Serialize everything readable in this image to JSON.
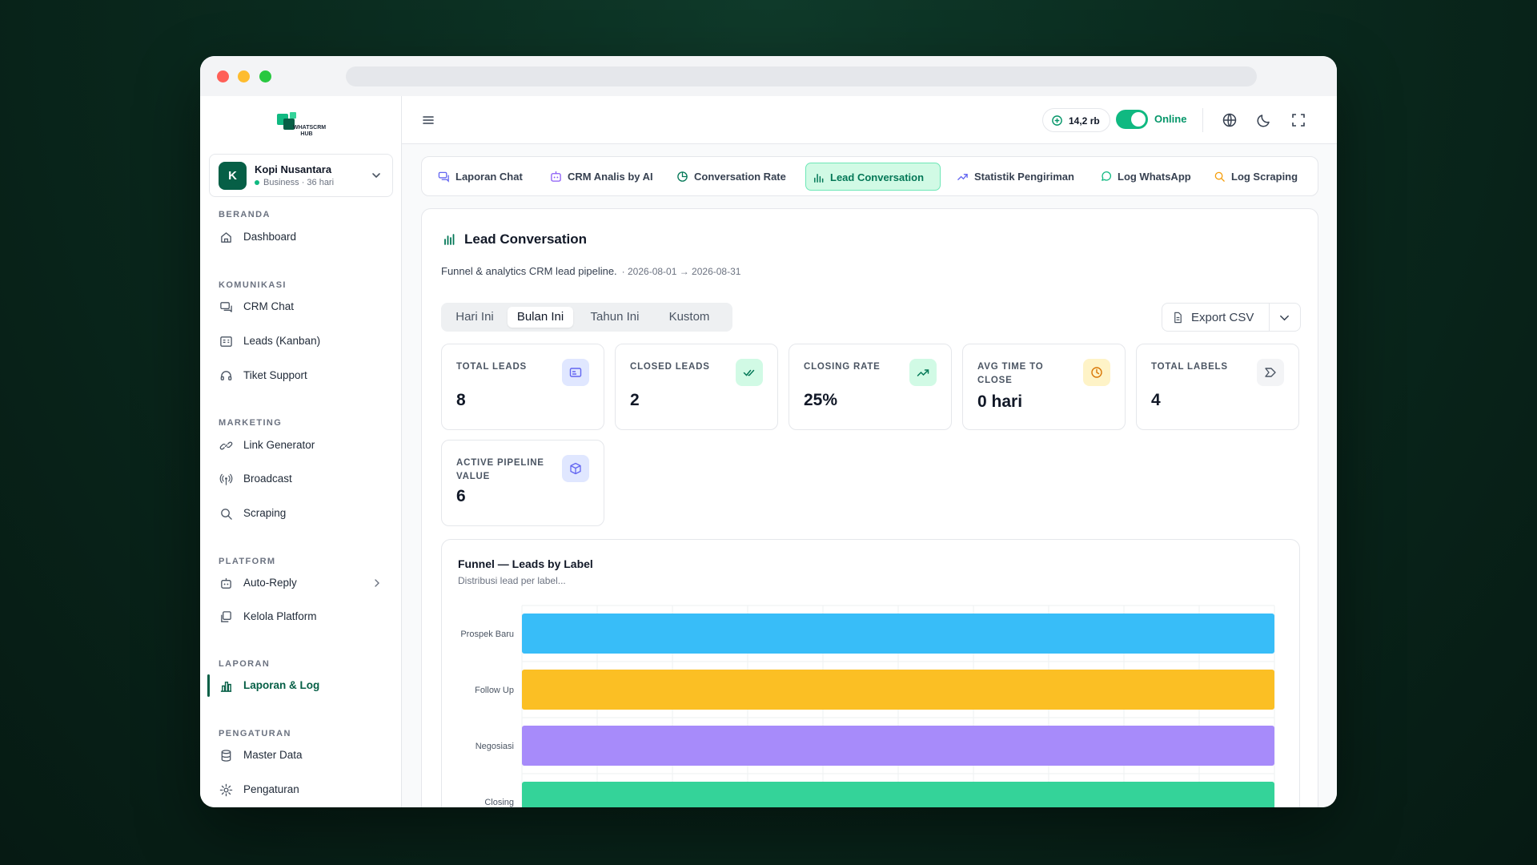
{
  "brand": {
    "name": "WHATSCRM HUB"
  },
  "account": {
    "initial": "K",
    "name": "Kopi Nusantara",
    "sub": "Business · 36 hari"
  },
  "sidebar": {
    "sections": [
      {
        "title": "BERANDA",
        "items": [
          {
            "label": "Dashboard",
            "icon": "home-icon"
          }
        ]
      },
      {
        "title": "KOMUNIKASI",
        "items": [
          {
            "label": "CRM Chat",
            "icon": "chat-icon"
          },
          {
            "label": "Leads (Kanban)",
            "icon": "kanban-icon"
          },
          {
            "label": "Tiket Support",
            "icon": "headset-icon"
          }
        ]
      },
      {
        "title": "MARKETING",
        "items": [
          {
            "label": "Link Generator",
            "icon": "link-icon"
          },
          {
            "label": "Broadcast",
            "icon": "broadcast-icon"
          },
          {
            "label": "Scraping",
            "icon": "search-icon"
          }
        ]
      },
      {
        "title": "PLATFORM",
        "items": [
          {
            "label": "Auto-Reply",
            "icon": "bot-icon"
          },
          {
            "label": "Kelola Platform",
            "icon": "platform-icon"
          }
        ]
      },
      {
        "title": "LAPORAN",
        "items": [
          {
            "label": "Laporan & Log",
            "icon": "bar-chart-icon",
            "active": true
          }
        ]
      },
      {
        "title": "PENGATURAN",
        "items": [
          {
            "label": "Master Data",
            "icon": "database-icon"
          },
          {
            "label": "Pengaturan",
            "icon": "gear-icon"
          }
        ]
      }
    ]
  },
  "topbar": {
    "credit": "14,2 rb",
    "status": "Online"
  },
  "tabs": [
    {
      "label": "Laporan Chat",
      "icon": "chat-icon"
    },
    {
      "label": "CRM Analis by AI",
      "icon": "bot-icon"
    },
    {
      "label": "Conversation Rate",
      "icon": "pie-icon"
    },
    {
      "label": "Lead Conversation",
      "icon": "bar-chart-icon",
      "active": true
    },
    {
      "label": "Statistik Pengiriman",
      "icon": "trend-icon"
    },
    {
      "label": "Log WhatsApp",
      "icon": "whatsapp-icon"
    },
    {
      "label": "Log Scraping",
      "icon": "search-icon"
    }
  ],
  "panel": {
    "title": "Lead Conversation",
    "subtitle": "Funnel & analytics CRM lead pipeline.",
    "date_range": "· 2026-08-01 → 2026-08-31",
    "ranges": [
      "Hari Ini",
      "Bulan Ini",
      "Tahun Ini",
      "Kustom"
    ],
    "active_range": "Bulan Ini",
    "export_label": "Export CSV"
  },
  "stats": [
    {
      "label": "TOTAL LEADS",
      "value": "8",
      "icon": "id-card-icon",
      "color": "#6366f1"
    },
    {
      "label": "CLOSED LEADS",
      "value": "2",
      "icon": "double-check-icon",
      "color": "#10b981"
    },
    {
      "label": "CLOSING RATE",
      "value": "25%",
      "icon": "trend-up-icon",
      "color": "#10b981"
    },
    {
      "label": "AVG TIME TO CLOSE",
      "value": "0 hari",
      "icon": "clock-icon",
      "color": "#f59e0b"
    },
    {
      "label": "TOTAL LABELS",
      "value": "4",
      "icon": "tag-icon",
      "color": "#6b7280"
    },
    {
      "label": "ACTIVE PIPELINE VALUE",
      "value": "6",
      "icon": "box-icon",
      "color": "#6366f1"
    }
  ],
  "chart_data": {
    "type": "bar",
    "orientation": "horizontal",
    "title": "Funnel — Leads by Label",
    "subtitle": "Distribusi lead per label...",
    "categories": [
      "Prospek Baru",
      "Follow Up",
      "Negosiasi",
      "Closing"
    ],
    "values": [
      2,
      2,
      2,
      2
    ],
    "colors": [
      "#38bdf8",
      "#fbbf24",
      "#a78bfa",
      "#34d399"
    ],
    "xlim": [
      0,
      2
    ],
    "grid": true
  }
}
